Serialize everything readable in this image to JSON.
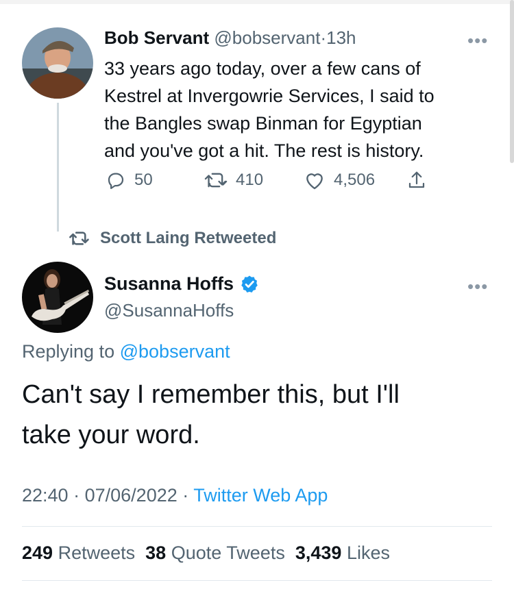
{
  "tweet1": {
    "name": "Bob Servant",
    "handle": "@bobservant",
    "separator": "·",
    "time": "13h",
    "text_lines": [
      "33 years ago today, over a few cans of",
      "Kestrel at Invergowrie Services, I said to",
      "the Bangles swap Binman for Egyptian",
      "and you've got a hit. The rest is history."
    ],
    "more": "•••",
    "replies": "50",
    "retweets": "410",
    "likes": "4,506"
  },
  "retweet_context": {
    "label": "Scott Laing Retweeted"
  },
  "tweet2": {
    "name": "Susanna Hoffs",
    "handle": "@SusannaHoffs",
    "more": "•••",
    "replying_prefix": "Replying to",
    "replying_handle": "@bobservant",
    "text_lines": [
      "Can't say I remember this, but I'll",
      "take your word."
    ],
    "time": "22:40",
    "date": "07/06/2022",
    "dot": "·",
    "source": "Twitter Web App",
    "stats": {
      "retweets_count": "249",
      "retweets_label": "Retweets",
      "quotes_count": "38",
      "quotes_label": "Quote Tweets",
      "likes_count": "3,439",
      "likes_label": "Likes"
    }
  },
  "colors": {
    "accent": "#1d9bf0",
    "secondary_text": "#536471",
    "primary_text": "#0f1419",
    "divider": "#e1e8ed"
  },
  "icons": [
    "reply-icon",
    "retweet-icon",
    "like-icon",
    "share-icon",
    "verified-badge-icon",
    "more-icon"
  ]
}
